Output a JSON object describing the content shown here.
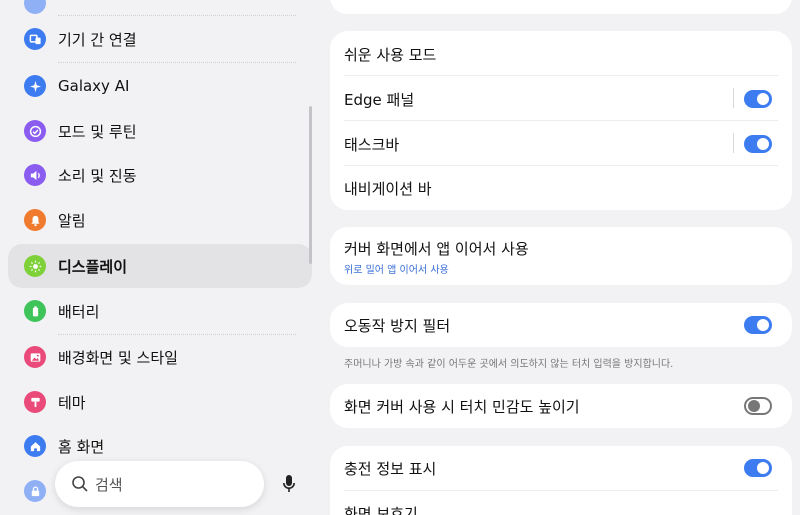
{
  "sidebar": {
    "items": [
      {
        "label": "기기 간 연결",
        "icon": "devices-icon",
        "color": "#3d7cf0"
      },
      {
        "label": "Galaxy AI",
        "icon": "ai-sparkle-icon",
        "color": "#3d7cf0"
      },
      {
        "label": "모드 및 루틴",
        "icon": "check-circle-icon",
        "color": "#8a5cf0"
      },
      {
        "label": "소리 및 진동",
        "icon": "speaker-icon",
        "color": "#8a5cf0"
      },
      {
        "label": "알림",
        "icon": "bell-icon",
        "color": "#f07a2e"
      },
      {
        "label": "디스플레이",
        "icon": "sun-icon",
        "color": "#7fd13a"
      },
      {
        "label": "배터리",
        "icon": "battery-icon",
        "color": "#3fc45a"
      },
      {
        "label": "배경화면 및 스타일",
        "icon": "image-icon",
        "color": "#e94a7a"
      },
      {
        "label": "테마",
        "icon": "brush-icon",
        "color": "#e94a7a"
      },
      {
        "label": "홈 화면",
        "icon": "home-icon",
        "color": "#3d7cf0"
      }
    ],
    "selected_index": 5,
    "search": {
      "placeholder": "검색"
    }
  },
  "main": {
    "card_navigation": {
      "rows": [
        {
          "label": "쉬운 사용 모드"
        },
        {
          "label": "Edge 패널",
          "toggle": true
        },
        {
          "label": "태스크바",
          "toggle": true
        },
        {
          "label": "내비게이션 바"
        }
      ]
    },
    "card_cover": {
      "label": "커버 화면에서 앱 이어서 사용",
      "sub": "위로 밀어 앱 이어서 사용"
    },
    "card_accidental": {
      "label": "오동작 방지 필터",
      "toggle": true,
      "helper": "주머니나 가방 속과 같이 어두운 곳에서 의도하지 않는 터치 입력을 방지합니다."
    },
    "card_touch": {
      "label": "화면 커버 사용 시 터치 민감도 높이기",
      "toggle": false
    },
    "card_charging": {
      "rows": [
        {
          "label": "충전 정보 표시",
          "toggle": true
        },
        {
          "label": "화면 보호기"
        }
      ]
    }
  }
}
